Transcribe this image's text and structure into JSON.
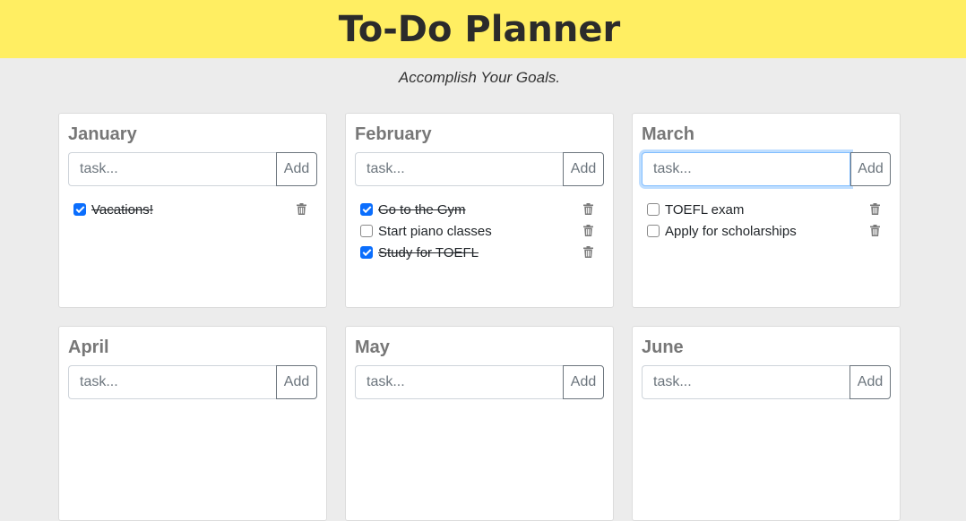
{
  "header": {
    "title": "To-Do Planner"
  },
  "subtitle": "Accomplish Your Goals.",
  "input": {
    "placeholder": "task...",
    "add_label": "Add"
  },
  "months": [
    {
      "name": "January",
      "focused": false,
      "tasks": [
        {
          "text": "Vacations!",
          "done": true
        }
      ]
    },
    {
      "name": "February",
      "focused": false,
      "tasks": [
        {
          "text": "Go to the Gym",
          "done": true
        },
        {
          "text": "Start piano classes",
          "done": false
        },
        {
          "text": "Study for TOEFL",
          "done": true
        }
      ]
    },
    {
      "name": "March",
      "focused": true,
      "tasks": [
        {
          "text": "TOEFL exam",
          "done": false
        },
        {
          "text": "Apply for scholarships",
          "done": false
        }
      ]
    },
    {
      "name": "April",
      "focused": false,
      "tasks": []
    },
    {
      "name": "May",
      "focused": false,
      "tasks": []
    },
    {
      "name": "June",
      "focused": false,
      "tasks": []
    }
  ],
  "colors": {
    "header_bg": "#ffee62",
    "page_bg": "#ececec",
    "checkbox_checked": "#0b6efd"
  },
  "icons": {
    "delete": "trash-icon"
  }
}
